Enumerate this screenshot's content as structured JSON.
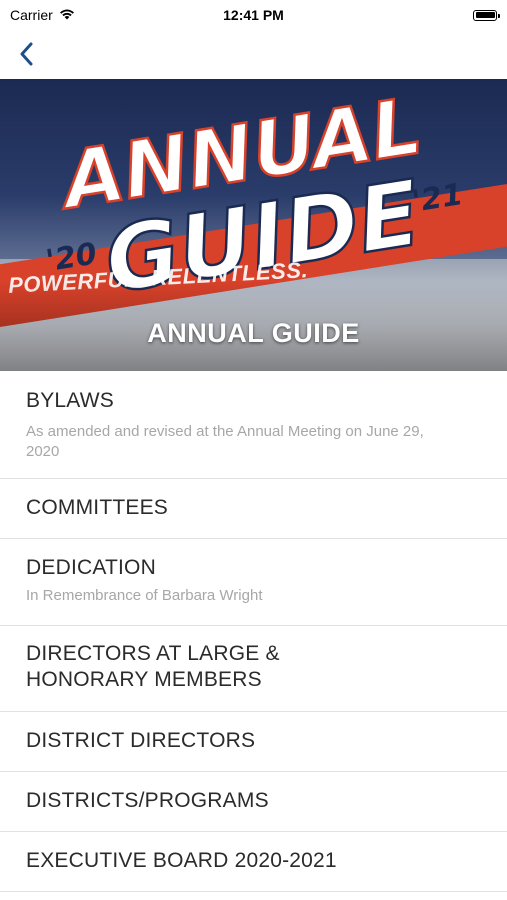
{
  "status_bar": {
    "carrier": "Carrier",
    "time": "12:41 PM"
  },
  "nav": {
    "back_icon": "chevron-left-icon"
  },
  "hero": {
    "banner_word1": "ANNUAL",
    "banner_word2": "GUIDE",
    "year_left": "'20",
    "year_right": "'21",
    "sign_text": "POWERFUL. RELENTLESS.",
    "caption": "ANNUAL GUIDE"
  },
  "items": [
    {
      "title": "BYLAWS",
      "subtitle": "As amended and revised at the Annual Meeting on June 29, 2020"
    },
    {
      "title": "COMMITTEES"
    },
    {
      "title": "DEDICATION",
      "subtitle": "In Remembrance of Barbara Wright"
    },
    {
      "title": "DIRECTORS AT LARGE & HONORARY MEMBERS"
    },
    {
      "title": "DISTRICT DIRECTORS"
    },
    {
      "title": "DISTRICTS/PROGRAMS"
    },
    {
      "title": "EXECUTIVE BOARD 2020-2021"
    }
  ],
  "colors": {
    "accent": "#1f4f8a",
    "banner_red": "#d8412a",
    "banner_navy": "#1b2a52"
  }
}
